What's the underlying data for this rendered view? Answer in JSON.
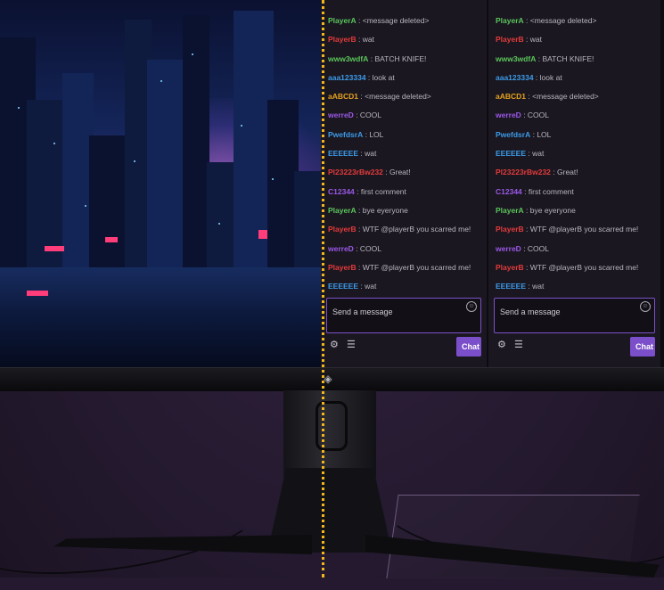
{
  "left_chat": {
    "messages": [
      {
        "user": "PlayerA",
        "text": "<message deleted>",
        "color": "#5bc45b"
      },
      {
        "user": "PlayerB",
        "text": "wat",
        "color": "#e33b3b"
      },
      {
        "user": "www3wdfA",
        "text": "BATCH KNIFE!",
        "color": "#5bc45b"
      },
      {
        "user": "aaa123334",
        "text": "look at",
        "color": "#3d9be9"
      },
      {
        "user": "aABCD1",
        "text": "<message deleted>",
        "color": "#e6a11f"
      },
      {
        "user": "werreD",
        "text": "COOL",
        "color": "#9b58e6"
      },
      {
        "user": "PwefdsrA",
        "text": "LOL",
        "color": "#3d9be9"
      },
      {
        "user": "EEEEEE",
        "text": "wat",
        "color": "#3d9be9"
      },
      {
        "user": "Pl23223rBw232",
        "text": "Great!",
        "color": "#e33b3b"
      },
      {
        "user": "C12344",
        "text": "first comment",
        "color": "#9b58e6"
      },
      {
        "user": "PlayerA",
        "text": "bye eyeryone",
        "color": "#5bc45b"
      },
      {
        "user": "PlayerB",
        "text": "WTF @playerB you scarred me!",
        "color": "#e33b3b"
      },
      {
        "user": "werreD",
        "text": "COOL",
        "color": "#9b58e6"
      },
      {
        "user": "PlayerB",
        "text": "WTF @playerB you scarred me!",
        "color": "#e33b3b"
      },
      {
        "user": "EEEEEE",
        "text": "wat",
        "color": "#3d9be9"
      }
    ],
    "input_placeholder": "Send a message",
    "chat_button": "Chat",
    "icons": {
      "emoji": "emoji-icon",
      "settings": "gear-icon",
      "list": "list-icon"
    }
  },
  "right_chat": {
    "messages": [
      {
        "user": "PlayerA",
        "text": "<message deleted>",
        "color": "#5bc45b"
      },
      {
        "user": "PlayerB",
        "text": "wat",
        "color": "#e33b3b"
      },
      {
        "user": "www3wdfA",
        "text": "BATCH KNIFE!",
        "color": "#5bc45b"
      },
      {
        "user": "aaa123334",
        "text": "look at",
        "color": "#3d9be9"
      },
      {
        "user": "aABCD1",
        "text": "<message deleted>",
        "color": "#e6a11f"
      },
      {
        "user": "werreD",
        "text": "COOL",
        "color": "#9b58e6"
      },
      {
        "user": "PwefdsrA",
        "text": "LOL",
        "color": "#3d9be9"
      },
      {
        "user": "EEEEEE",
        "text": "wat",
        "color": "#3d9be9"
      },
      {
        "user": "Pl23223rBw232",
        "text": "Great!",
        "color": "#e33b3b"
      },
      {
        "user": "C12344",
        "text": "first comment",
        "color": "#9b58e6"
      },
      {
        "user": "PlayerA",
        "text": "bye eyeryone",
        "color": "#5bc45b"
      },
      {
        "user": "PlayerB",
        "text": "WTF @playerB you scarred me!",
        "color": "#e33b3b"
      },
      {
        "user": "werreD",
        "text": "COOL",
        "color": "#9b58e6"
      },
      {
        "user": "PlayerB",
        "text": "WTF @playerB you scarred me!",
        "color": "#e33b3b"
      },
      {
        "user": "EEEEEE",
        "text": "wat",
        "color": "#3d9be9"
      }
    ],
    "input_placeholder": "Send a message",
    "chat_button": "Chat",
    "icons": {
      "emoji": "emoji-icon",
      "settings": "gear-icon",
      "list": "list-icon"
    }
  },
  "colors": {
    "accent": "#7b4fc9",
    "divider_line": "#f2b51e"
  }
}
